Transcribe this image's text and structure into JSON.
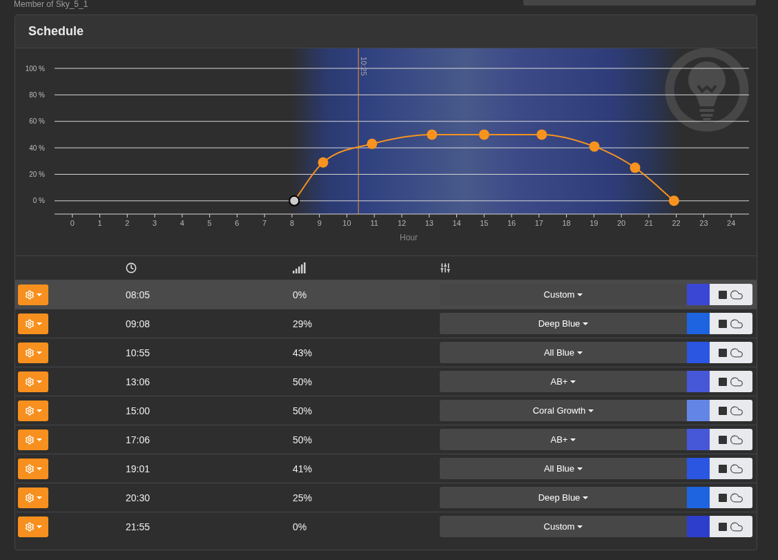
{
  "membership": "Member of Sky_5_1",
  "schedule": {
    "title": "Schedule",
    "chart_data": {
      "type": "line",
      "xlabel": "Hour",
      "x": [
        8.083,
        9.133,
        10.917,
        13.1,
        15,
        17.1,
        19.017,
        20.5,
        21.917
      ],
      "series": [
        {
          "color": "#f7931e",
          "marker": "circle",
          "values": [
            0,
            29,
            43,
            50,
            50,
            50,
            41,
            25,
            0
          ]
        }
      ],
      "xlim": [
        -0.65,
        24.65
      ],
      "ylim": [
        -10,
        100
      ],
      "xticks": [
        0,
        1,
        2,
        3,
        4,
        5,
        6,
        7,
        8,
        9,
        10,
        11,
        12,
        13,
        14,
        15,
        16,
        17,
        18,
        19,
        20,
        21,
        22,
        23,
        24
      ],
      "yticks": [
        {
          "value": 0,
          "label": "0 %"
        },
        {
          "value": 20,
          "label": "20 %"
        },
        {
          "value": 40,
          "label": "40 %"
        },
        {
          "value": 60,
          "label": "60 %"
        },
        {
          "value": 80,
          "label": "80 %"
        },
        {
          "value": 100,
          "label": "100 %"
        }
      ],
      "grid": true,
      "ref_lines": [
        {
          "axis": "x",
          "value": 10.42,
          "label": "10:25",
          "color": "#f7931e"
        }
      ]
    },
    "rows": [
      {
        "time": "08:05",
        "intensity": "0%",
        "preset": "Custom",
        "color": "#3a47d5",
        "selected": true
      },
      {
        "time": "09:08",
        "intensity": "29%",
        "preset": "Deep Blue",
        "color": "#1e64e0",
        "selected": false
      },
      {
        "time": "10:55",
        "intensity": "43%",
        "preset": "All Blue",
        "color": "#2a56e2",
        "selected": false
      },
      {
        "time": "13:06",
        "intensity": "50%",
        "preset": "AB+",
        "color": "#4658d8",
        "selected": false
      },
      {
        "time": "15:00",
        "intensity": "50%",
        "preset": "Coral Growth",
        "color": "#6386e6",
        "selected": false
      },
      {
        "time": "17:06",
        "intensity": "50%",
        "preset": "AB+",
        "color": "#4658d8",
        "selected": false
      },
      {
        "time": "19:01",
        "intensity": "41%",
        "preset": "All Blue",
        "color": "#2a56e2",
        "selected": false
      },
      {
        "time": "20:30",
        "intensity": "25%",
        "preset": "Deep Blue",
        "color": "#1e64e0",
        "selected": false
      },
      {
        "time": "21:55",
        "intensity": "0%",
        "preset": "Custom",
        "color": "#2e3ecc",
        "selected": false
      }
    ]
  }
}
